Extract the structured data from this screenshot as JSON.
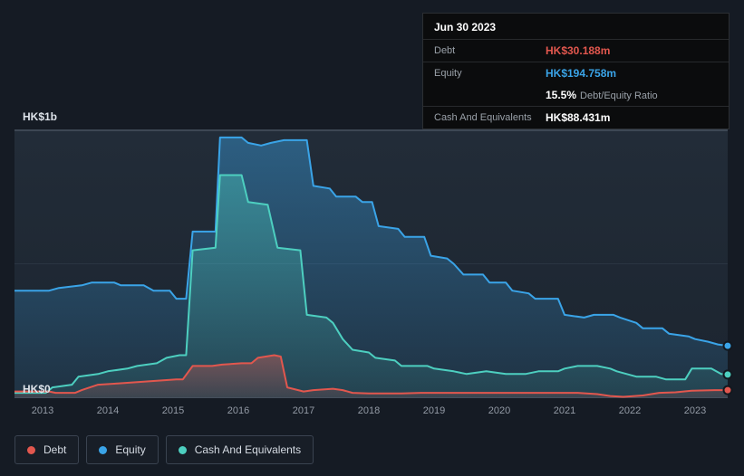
{
  "colors": {
    "background": "#151b24",
    "panel": "#1f2934",
    "debt": "#e2574e",
    "equity": "#3aa4e8",
    "cash": "#4dcfc0",
    "cash_value_text": "#ffffff"
  },
  "tooltip": {
    "date": "Jun 30 2023",
    "debt_label": "Debt",
    "debt_value": "HK$30.188m",
    "equity_label": "Equity",
    "equity_value": "HK$194.758m",
    "ratio_value": "15.5%",
    "ratio_label": "Debt/Equity Ratio",
    "cash_label": "Cash And Equivalents",
    "cash_value": "HK$88.431m"
  },
  "axis": {
    "y_top": "HK$1b",
    "y_bottom": "HK$0"
  },
  "legend": [
    {
      "label": "Debt",
      "color": "#e2574e"
    },
    {
      "label": "Equity",
      "color": "#3aa4e8"
    },
    {
      "label": "Cash And Equivalents",
      "color": "#4dcfc0"
    }
  ],
  "chart_data": {
    "type": "area",
    "title": "Debt, Equity and Cash history (HK$, billions)",
    "x_unit": "year",
    "x_range": [
      2012.57,
      2023.5
    ],
    "ylim": [
      0,
      1
    ],
    "y_tick_labels": [
      "HK$0",
      "HK$1b"
    ],
    "x_ticks": [
      2013,
      2014,
      2015,
      2016,
      2017,
      2018,
      2019,
      2020,
      2021,
      2022,
      2023
    ],
    "grid": "horizontal",
    "legend_position": "bottom-left",
    "series": [
      {
        "name": "Equity",
        "color": "#3aa4e8",
        "last_value_label": "HK$194.758m",
        "points": [
          [
            2012.57,
            0.4
          ],
          [
            2013.1,
            0.4
          ],
          [
            2013.25,
            0.41
          ],
          [
            2013.6,
            0.42
          ],
          [
            2013.75,
            0.43
          ],
          [
            2014.1,
            0.43
          ],
          [
            2014.2,
            0.42
          ],
          [
            2014.55,
            0.42
          ],
          [
            2014.7,
            0.4
          ],
          [
            2014.95,
            0.4
          ],
          [
            2015.05,
            0.37
          ],
          [
            2015.2,
            0.37
          ],
          [
            2015.3,
            0.62
          ],
          [
            2015.65,
            0.62
          ],
          [
            2015.72,
            0.97
          ],
          [
            2016.05,
            0.97
          ],
          [
            2016.15,
            0.95
          ],
          [
            2016.35,
            0.94
          ],
          [
            2016.5,
            0.95
          ],
          [
            2016.7,
            0.96
          ],
          [
            2017.05,
            0.96
          ],
          [
            2017.15,
            0.79
          ],
          [
            2017.4,
            0.78
          ],
          [
            2017.5,
            0.75
          ],
          [
            2017.8,
            0.75
          ],
          [
            2017.9,
            0.73
          ],
          [
            2018.05,
            0.73
          ],
          [
            2018.15,
            0.64
          ],
          [
            2018.45,
            0.63
          ],
          [
            2018.55,
            0.6
          ],
          [
            2018.85,
            0.6
          ],
          [
            2018.95,
            0.53
          ],
          [
            2019.2,
            0.52
          ],
          [
            2019.3,
            0.5
          ],
          [
            2019.45,
            0.46
          ],
          [
            2019.75,
            0.46
          ],
          [
            2019.85,
            0.43
          ],
          [
            2020.1,
            0.43
          ],
          [
            2020.2,
            0.4
          ],
          [
            2020.45,
            0.39
          ],
          [
            2020.55,
            0.37
          ],
          [
            2020.9,
            0.37
          ],
          [
            2021.0,
            0.31
          ],
          [
            2021.3,
            0.3
          ],
          [
            2021.45,
            0.31
          ],
          [
            2021.75,
            0.31
          ],
          [
            2021.85,
            0.3
          ],
          [
            2022.1,
            0.28
          ],
          [
            2022.2,
            0.26
          ],
          [
            2022.5,
            0.26
          ],
          [
            2022.6,
            0.24
          ],
          [
            2022.9,
            0.23
          ],
          [
            2023.0,
            0.22
          ],
          [
            2023.2,
            0.21
          ],
          [
            2023.35,
            0.2
          ],
          [
            2023.5,
            0.195
          ]
        ]
      },
      {
        "name": "Cash And Equivalents",
        "color": "#4dcfc0",
        "last_value_label": "HK$88.431m",
        "points": [
          [
            2012.57,
            0.02
          ],
          [
            2013.05,
            0.02
          ],
          [
            2013.15,
            0.04
          ],
          [
            2013.45,
            0.05
          ],
          [
            2013.55,
            0.08
          ],
          [
            2013.85,
            0.09
          ],
          [
            2014.0,
            0.1
          ],
          [
            2014.3,
            0.11
          ],
          [
            2014.45,
            0.12
          ],
          [
            2014.75,
            0.13
          ],
          [
            2014.9,
            0.15
          ],
          [
            2015.1,
            0.16
          ],
          [
            2015.2,
            0.16
          ],
          [
            2015.3,
            0.55
          ],
          [
            2015.65,
            0.56
          ],
          [
            2015.72,
            0.83
          ],
          [
            2016.05,
            0.83
          ],
          [
            2016.15,
            0.73
          ],
          [
            2016.45,
            0.72
          ],
          [
            2016.6,
            0.56
          ],
          [
            2016.95,
            0.55
          ],
          [
            2017.05,
            0.31
          ],
          [
            2017.35,
            0.3
          ],
          [
            2017.45,
            0.28
          ],
          [
            2017.6,
            0.22
          ],
          [
            2017.75,
            0.18
          ],
          [
            2018.0,
            0.17
          ],
          [
            2018.1,
            0.15
          ],
          [
            2018.4,
            0.14
          ],
          [
            2018.5,
            0.12
          ],
          [
            2018.9,
            0.12
          ],
          [
            2019.0,
            0.11
          ],
          [
            2019.3,
            0.1
          ],
          [
            2019.5,
            0.09
          ],
          [
            2019.8,
            0.1
          ],
          [
            2020.1,
            0.09
          ],
          [
            2020.4,
            0.09
          ],
          [
            2020.6,
            0.1
          ],
          [
            2020.9,
            0.1
          ],
          [
            2021.0,
            0.11
          ],
          [
            2021.2,
            0.12
          ],
          [
            2021.5,
            0.12
          ],
          [
            2021.7,
            0.11
          ],
          [
            2021.8,
            0.1
          ],
          [
            2022.1,
            0.08
          ],
          [
            2022.4,
            0.08
          ],
          [
            2022.55,
            0.07
          ],
          [
            2022.85,
            0.07
          ],
          [
            2022.95,
            0.11
          ],
          [
            2023.25,
            0.11
          ],
          [
            2023.4,
            0.09
          ],
          [
            2023.5,
            0.088
          ]
        ]
      },
      {
        "name": "Debt",
        "color": "#e2574e",
        "last_value_label": "HK$30.188m",
        "points": [
          [
            2012.57,
            0.025
          ],
          [
            2013.1,
            0.025
          ],
          [
            2013.2,
            0.02
          ],
          [
            2013.5,
            0.02
          ],
          [
            2013.6,
            0.03
          ],
          [
            2013.85,
            0.05
          ],
          [
            2014.15,
            0.055
          ],
          [
            2014.45,
            0.06
          ],
          [
            2014.75,
            0.065
          ],
          [
            2015.05,
            0.07
          ],
          [
            2015.15,
            0.07
          ],
          [
            2015.3,
            0.12
          ],
          [
            2015.6,
            0.12
          ],
          [
            2015.75,
            0.125
          ],
          [
            2016.05,
            0.13
          ],
          [
            2016.2,
            0.13
          ],
          [
            2016.3,
            0.15
          ],
          [
            2016.55,
            0.16
          ],
          [
            2016.65,
            0.155
          ],
          [
            2016.75,
            0.04
          ],
          [
            2017.0,
            0.025
          ],
          [
            2017.15,
            0.03
          ],
          [
            2017.45,
            0.035
          ],
          [
            2017.6,
            0.03
          ],
          [
            2017.75,
            0.02
          ],
          [
            2018.0,
            0.018
          ],
          [
            2018.5,
            0.018
          ],
          [
            2018.8,
            0.02
          ],
          [
            2019.3,
            0.02
          ],
          [
            2019.8,
            0.02
          ],
          [
            2020.3,
            0.02
          ],
          [
            2020.8,
            0.02
          ],
          [
            2021.2,
            0.02
          ],
          [
            2021.5,
            0.015
          ],
          [
            2021.7,
            0.008
          ],
          [
            2021.9,
            0.005
          ],
          [
            2022.2,
            0.01
          ],
          [
            2022.45,
            0.02
          ],
          [
            2022.7,
            0.022
          ],
          [
            2022.95,
            0.028
          ],
          [
            2023.3,
            0.03
          ],
          [
            2023.5,
            0.03
          ]
        ]
      }
    ]
  }
}
